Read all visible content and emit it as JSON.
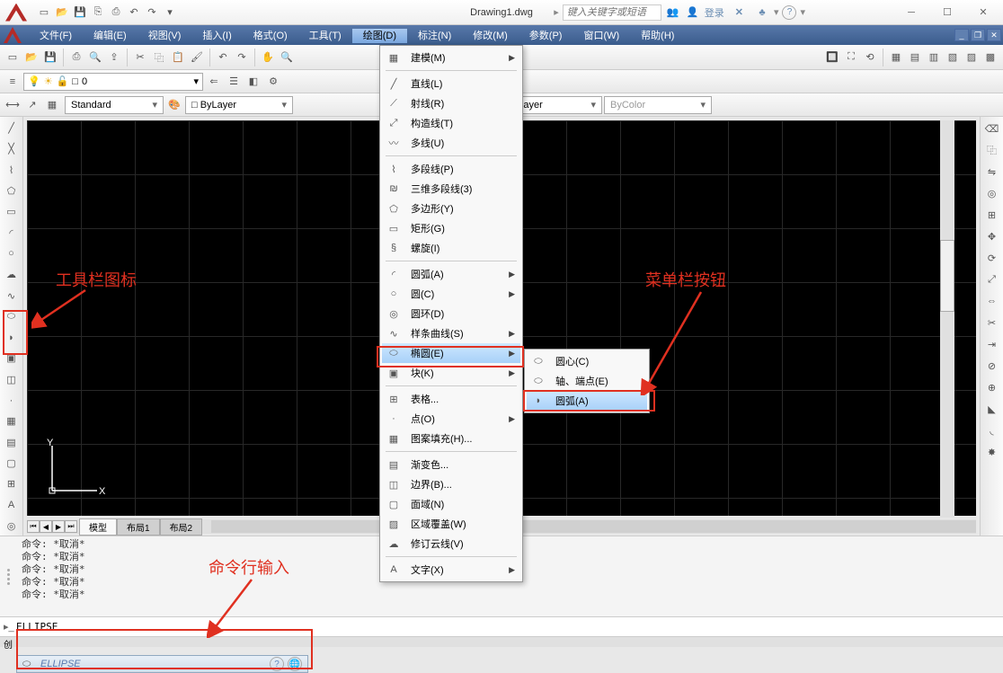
{
  "title": "Drawing1.dwg",
  "search_placeholder": "键入关键字或短语",
  "login": "登录",
  "menus": [
    "文件(F)",
    "编辑(E)",
    "视图(V)",
    "插入(I)",
    "格式(O)",
    "工具(T)",
    "绘图(D)",
    "标注(N)",
    "修改(M)",
    "参数(P)",
    "窗口(W)",
    "帮助(H)"
  ],
  "active_menu_index": 6,
  "layer": {
    "current": "0"
  },
  "style": {
    "textstyle": "Standard",
    "layer_color": "ByLayer",
    "linetype": "ByLayer",
    "bycolor": "ByColor"
  },
  "draw_menu": [
    {
      "label": "建模(M)",
      "sub": true
    },
    {
      "sep": true
    },
    {
      "label": "直线(L)"
    },
    {
      "label": "射线(R)"
    },
    {
      "label": "构造线(T)"
    },
    {
      "label": "多线(U)"
    },
    {
      "sep": true
    },
    {
      "label": "多段线(P)"
    },
    {
      "label": "三维多段线(3)"
    },
    {
      "label": "多边形(Y)"
    },
    {
      "label": "矩形(G)"
    },
    {
      "label": "螺旋(I)"
    },
    {
      "sep": true
    },
    {
      "label": "圆弧(A)",
      "sub": true
    },
    {
      "label": "圆(C)",
      "sub": true
    },
    {
      "label": "圆环(D)"
    },
    {
      "label": "样条曲线(S)",
      "sub": true
    },
    {
      "label": "椭圆(E)",
      "sub": true,
      "hl": true
    },
    {
      "label": "块(K)",
      "sub": true
    },
    {
      "sep": true
    },
    {
      "label": "表格..."
    },
    {
      "label": "点(O)",
      "sub": true
    },
    {
      "label": "图案填充(H)..."
    },
    {
      "sep": true
    },
    {
      "label": "渐变色..."
    },
    {
      "label": "边界(B)..."
    },
    {
      "label": "面域(N)"
    },
    {
      "label": "区域覆盖(W)"
    },
    {
      "label": "修订云线(V)"
    },
    {
      "sep": true
    },
    {
      "label": "文字(X)",
      "sub": true
    }
  ],
  "ellipse_menu": [
    {
      "label": "圆心(C)"
    },
    {
      "label": "轴、端点(E)"
    },
    {
      "label": "圆弧(A)",
      "hl": true
    }
  ],
  "tabs": [
    "模型",
    "布局1",
    "布局2"
  ],
  "active_tab": 0,
  "cmd_history": [
    "命令: *取消*",
    "命令: *取消*",
    "命令: *取消*",
    "命令: *取消*",
    "命令: *取消*"
  ],
  "cmd_input": "ELLIPSE",
  "autocomplete": "ELLIPSE",
  "annotations": {
    "toolbar": "工具栏图标",
    "menubtn": "菜单栏按钮",
    "cmdline": "命令行输入"
  },
  "status_prefix": "创"
}
